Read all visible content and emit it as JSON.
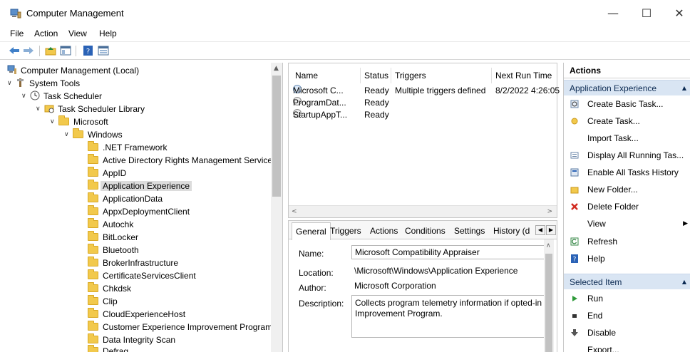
{
  "window": {
    "title": "Computer Management",
    "controls": {
      "minimize": "—",
      "maximize": "☐",
      "close": "✕"
    }
  },
  "menu": [
    "File",
    "Action",
    "View",
    "Help"
  ],
  "tree": {
    "root": "Computer Management (Local)",
    "system_tools": "System Tools",
    "task_scheduler": "Task Scheduler",
    "library": "Task Scheduler Library",
    "microsoft": "Microsoft",
    "windows": "Windows",
    "folders": [
      ".NET Framework",
      "Active Directory Rights Management Services",
      "AppID",
      "Application Experience",
      "ApplicationData",
      "AppxDeploymentClient",
      "Autochk",
      "BitLocker",
      "Bluetooth",
      "BrokerInfrastructure",
      "CertificateServicesClient",
      "Chkdsk",
      "Clip",
      "CloudExperienceHost",
      "Customer Experience Improvement Program",
      "Data Integrity Scan",
      "Defrag"
    ],
    "selected": "Application Experience"
  },
  "task_list": {
    "columns": [
      "Name",
      "Status",
      "Triggers",
      "Next Run Time"
    ],
    "rows": [
      {
        "name": "Microsoft C...",
        "status": "Ready",
        "triggers": "Multiple triggers defined",
        "next_run": "8/2/2022 4:26:05"
      },
      {
        "name": "ProgramDat...",
        "status": "Ready",
        "triggers": "",
        "next_run": ""
      },
      {
        "name": "StartupAppT...",
        "status": "Ready",
        "triggers": "",
        "next_run": ""
      }
    ]
  },
  "detail": {
    "tabs": [
      "General",
      "Triggers",
      "Actions",
      "Conditions",
      "Settings",
      "History (d"
    ],
    "active_tab": "General",
    "name_label": "Name:",
    "name_value": "Microsoft Compatibility Appraiser",
    "location_label": "Location:",
    "location_value": "\\Microsoft\\Windows\\Application Experience",
    "author_label": "Author:",
    "author_value": "Microsoft Corporation",
    "description_label": "Description:",
    "description_value": "Collects program telemetry information if opted-in Improvement Program."
  },
  "actions": {
    "title": "Actions",
    "group1": "Application Experience",
    "group1_items": [
      {
        "label": "Create Basic Task...",
        "icon": "create-basic-task-icon"
      },
      {
        "label": "Create Task...",
        "icon": "create-task-icon"
      },
      {
        "label": "Import Task...",
        "icon": ""
      },
      {
        "label": "Display All Running Tas...",
        "icon": "running-tasks-icon"
      },
      {
        "label": "Enable All Tasks History",
        "icon": "history-icon"
      },
      {
        "label": "New Folder...",
        "icon": "folder-icon"
      },
      {
        "label": "Delete Folder",
        "icon": "delete-icon"
      },
      {
        "label": "View",
        "icon": ""
      },
      {
        "label": "Refresh",
        "icon": "refresh-icon"
      },
      {
        "label": "Help",
        "icon": "help-icon"
      }
    ],
    "group2": "Selected Item",
    "group2_items": [
      {
        "label": "Run",
        "icon": "run-icon"
      },
      {
        "label": "End",
        "icon": "end-icon"
      },
      {
        "label": "Disable",
        "icon": "disable-icon"
      },
      {
        "label": "Export...",
        "icon": ""
      }
    ]
  },
  "colors": {
    "accent_header": "#d9e5f3",
    "selection": "#dcdcdc",
    "folder": "#f2c94c"
  }
}
